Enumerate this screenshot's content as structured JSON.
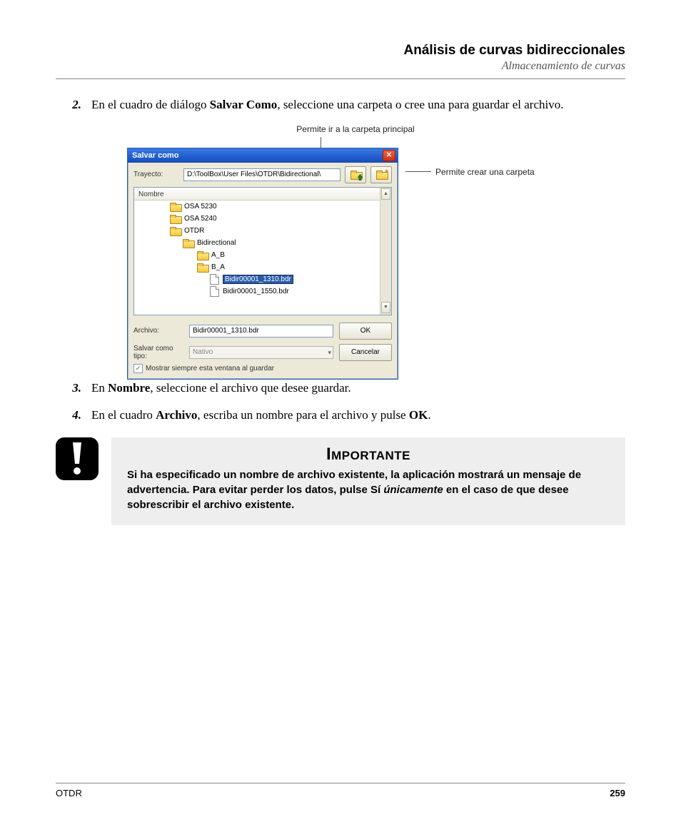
{
  "header": {
    "title": "Análisis de curvas bidireccionales",
    "subtitle": "Almacenamiento de curvas"
  },
  "steps": {
    "s2_num": "2.",
    "s2_a": "En el cuadro de diálogo ",
    "s2_b": "Salvar Como",
    "s2_c": ", seleccione una carpeta o cree una para guardar el archivo.",
    "s3_num": "3.",
    "s3_a": "En ",
    "s3_b": "Nombre",
    "s3_c": ", seleccione el archivo que desee guardar.",
    "s4_num": "4.",
    "s4_a": "En el cuadro ",
    "s4_b": "Archivo",
    "s4_c": ", escriba un nombre para el archivo y pulse ",
    "s4_d": "OK",
    "s4_e": "."
  },
  "callouts": {
    "top": "Permite ir a la carpeta principal",
    "right": "Permite crear una carpeta"
  },
  "dialog": {
    "title": "Salvar como",
    "path_label": "Trayecto:",
    "path_value": "D:\\ToolBox\\User Files\\OTDR\\Bidirectional\\",
    "list_header": "Nombre",
    "items": {
      "i0": "OSA 5230",
      "i1": "OSA 5240",
      "i2": "OTDR",
      "i3": "Bidirectional",
      "i4": "A_B",
      "i5": "B_A",
      "i6": "Bidir00001_1310.bdr",
      "i7": "Bidir00001_1550.bdr"
    },
    "file_label": "Archivo:",
    "file_value": "Bidir00001_1310.bdr",
    "type_label": "Salvar como tipo:",
    "type_value": "Nativo",
    "ok": "OK",
    "cancel": "Cancelar",
    "checkbox_label": "Mostrar siempre esta ventana al guardar",
    "checkbox_mark": "✓"
  },
  "note": {
    "title": "Importante",
    "t1": "Si ha especificado un nombre de archivo existente, la aplicación mostrará un mensaje de advertencia. Para evitar perder los datos, pulse Sí ",
    "t2": "únicamente",
    "t3": " en el caso de que desee sobrescribir el archivo existente."
  },
  "footer": {
    "left": "OTDR",
    "page": "259"
  }
}
